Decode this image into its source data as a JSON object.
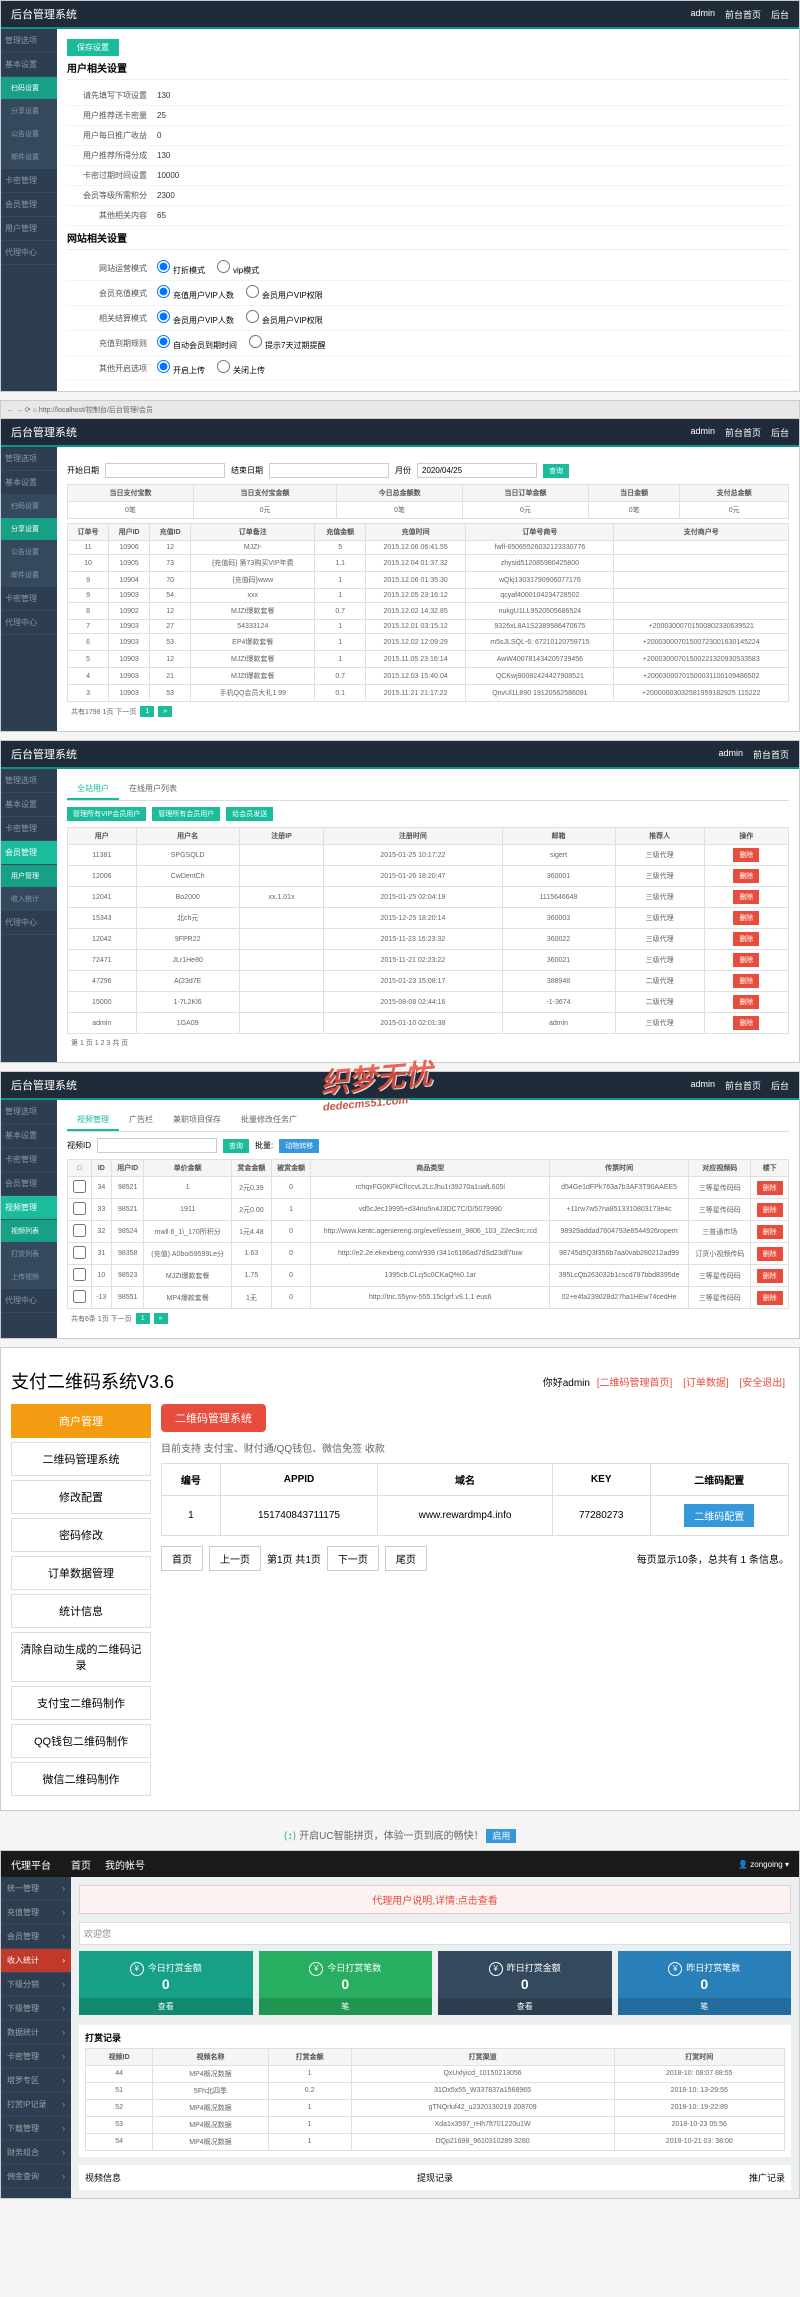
{
  "common": {
    "brand": "后台管理系统",
    "topRight": [
      "admin",
      "前台首页",
      "后台"
    ],
    "sidebarTop": [
      "管理选项",
      "基本设置"
    ],
    "sidebarSub": [
      "扫码设置",
      "分享设置",
      "公告设置",
      "邮件设置"
    ],
    "sidebarBottom": [
      "卡密管理",
      "会员管理",
      "用户管理",
      "代理中心"
    ]
  },
  "panel1": {
    "saveBtn": "保存设置",
    "section1": "用户相关设置",
    "rows1": [
      {
        "label": "请先填写下项设置",
        "value": "130"
      },
      {
        "label": "用户推荐送卡密量",
        "value": "25"
      },
      {
        "label": "用户每日推广收益",
        "value": "0"
      },
      {
        "label": "用户推荐所得分成",
        "value": "130"
      },
      {
        "label": "卡密过期时间设置",
        "value": "10000"
      },
      {
        "label": "会员等级所需积分",
        "value": "2300"
      },
      {
        "label": "其他相关内容",
        "value": "65"
      }
    ],
    "section2": "网站相关设置",
    "radioRows": [
      {
        "label": "网站运营模式",
        "opts": [
          "打折模式",
          "vip模式"
        ]
      },
      {
        "label": "会员充值模式",
        "opts": [
          "充值用户VIP人数",
          "会员用户VIP权限"
        ]
      },
      {
        "label": "相关结算模式",
        "opts": [
          "会员用户VIP人数",
          "会员用户VIP权限"
        ]
      },
      {
        "label": "充值到期规则",
        "opts": [
          "自动会员到期时间",
          "提示7天过期提醒"
        ]
      },
      {
        "label": "其他开启选项",
        "opts": [
          "开启上传",
          "关闭上传"
        ]
      }
    ]
  },
  "panel2": {
    "chrome": "← → ⟳ ⌂ http://localhost/控制台/后台管理/会员",
    "filter": {
      "start": "开始日期",
      "end": "结束日期",
      "month": "月份",
      "monthVal": "2020/04/25",
      "search": "查询"
    },
    "subHeaders": [
      "当日支付宝数",
      "当日支付宝金额",
      "今日总金额数",
      "当日订单金额",
      "当日金额",
      "支付总金额"
    ],
    "subValues": [
      "0笔",
      "0元",
      "0笔",
      "0元",
      "0笔",
      "0元"
    ],
    "cols": [
      "订单号",
      "用户ID",
      "充值ID",
      "订单备注",
      "充值金额",
      "充值时间",
      "订单号商号",
      "支付商户号"
    ],
    "rows": [
      [
        "11",
        "10906",
        "12",
        "MJZt-",
        "5",
        "2015.12.06 06:41.55",
        "fwfl-65065526032123330776",
        ""
      ],
      [
        "10",
        "10905",
        "73",
        "{充值码} 第73购买VIP年费",
        "1.1",
        "2015.12.04 01:37.32",
        "zhysid512085980425800",
        ""
      ],
      [
        "9",
        "10904",
        "70",
        "{充值码}www",
        "1",
        "2015.12.06 01:35.30",
        "wQkj13031790906077176",
        ""
      ],
      [
        "9",
        "10903",
        "54",
        "xxx",
        "1",
        "2015.12.05 23:16:12",
        "qcyaf4000104234728502",
        ""
      ],
      [
        "8",
        "10902",
        "12",
        "MJZt爆款套餐",
        "0.7",
        "2015.12.02 14:32.85",
        "nukgU1LL9520505686524",
        ""
      ],
      [
        "7",
        "10903",
        "27",
        "54333124",
        "1",
        "2015.12.01 03:15.12",
        "9326xL8A1S2389586470675",
        "+20003000701500802330639521"
      ],
      [
        "6",
        "10903",
        "53",
        "EP4爆款套餐",
        "1",
        "2015.12.02 12:09:29",
        "m5sJLSQL-6: 67210120759715",
        "+20003000701500723001630145224"
      ],
      [
        "5",
        "10903",
        "12",
        "MJZt爆款套餐",
        "1",
        "2015.11.05 23:16:14",
        "AwW400781434205739456",
        "+20003000701500221320930533583"
      ],
      [
        "4",
        "10903",
        "21",
        "MJZt爆款套餐",
        "0.7",
        "2015.12.03 15:40.04",
        "QCKwj90082424427908521",
        "+20003000701500031100109486502"
      ],
      [
        "3",
        "10903",
        "53",
        "手机QQ会员大礼1.99",
        "0.1",
        "2015.11.21 21:17:22",
        "QnvUl1L890 19120562586091",
        "+20000003032581959182925 115222"
      ]
    ],
    "pager": "共有1798 1页 下一页"
  },
  "panel3": {
    "tabs": [
      "全站用户",
      "在线用户列表"
    ],
    "btns": [
      "管理所有VIP会员用户",
      "管理所有会员用户",
      "给会员发送"
    ],
    "cols": [
      "用户",
      "用户名",
      "注册IP",
      "注册时间",
      "邮箱",
      "推荐人",
      "操作"
    ],
    "rows": [
      [
        "11381",
        "SPGSQLD",
        "",
        "2015-01-25 10:17:22",
        "sigert",
        "三级代理",
        "删除"
      ],
      [
        "12006",
        "CwDentCh",
        "",
        "2015-01-26 18:20:47",
        "360001",
        "三级代理",
        "删除"
      ],
      [
        "12041",
        "Bo2000",
        "xx.1.01x",
        "2015-01-25 02:04:19",
        "1115646648",
        "三级代理",
        "删除"
      ],
      [
        "15343",
        "北ch元",
        "",
        "2015-12-25 18:20:14",
        "360003",
        "三级代理",
        "删除"
      ],
      [
        "12042",
        "9FPR22",
        "",
        "2015-11-23 16:23:32",
        "360022",
        "三级代理",
        "删除"
      ],
      [
        "72471",
        "JLr1He80",
        "",
        "2015-11-21 02:23:22",
        "360021",
        "三级代理",
        "删除"
      ],
      [
        "47296",
        "A(23d7E",
        "",
        "2015-01-23 15:08:17",
        "388948",
        "二级代理",
        "删除"
      ],
      [
        "15000",
        "1-7L2Kl6",
        "",
        "2015-08-08 02:44:16",
        "-1-3674",
        "二级代理",
        "删除"
      ],
      [
        "admin",
        "1GA09",
        "",
        "2015-01-10 02:01:38",
        "admin",
        "三级代理",
        "删除"
      ]
    ],
    "pager": "第 1 页 1 2 3 共 页"
  },
  "panel4": {
    "tabs": [
      "视频管理",
      "广告栏",
      "兼职项目保存",
      "批量修改任务广"
    ],
    "watermark": "织梦无忧",
    "watermarkUrl": "dedecms51.com",
    "cols": [
      "□",
      "ID",
      "用户ID",
      "单价金额",
      "赏金金额",
      "被赏金额",
      "商品类型",
      "传票时间",
      "对应视频码",
      "楼下"
    ],
    "rows": [
      [
        "□",
        "34",
        "98521",
        "1",
        "2元0.39",
        "0",
        "rchqxFG0KFkCfIccvL2LcJhu1r39270a1uafL605l",
        "d54Ge1dFPk763a7b3AF3T90AAEE5",
        "三等星传码码",
        "删除"
      ],
      [
        "□",
        "33",
        "98521",
        "1911",
        "2元0.00",
        "1",
        "vd5cJec19995+d34nu5n4J3DC7C/D/5079990",
        "+11rw7w57na8513310803173e4c",
        "三等星传码码",
        "删除"
      ],
      [
        "□",
        "32",
        "98524",
        "mwll 6_1\\_170所积分",
        "1元4.48",
        "0",
        "http://www.kentc.ageniereng.org/evef/essent_9806_103_22ec9rc.rcd",
        "98929addad7604793e8544926ropem",
        "三普通市场",
        "删除"
      ],
      [
        "□",
        "31",
        "98358",
        "(充值) A0boi59599Le分",
        "1.63",
        "0",
        "http://e2.2e.ekexberg.com/r939 r341c6186ad7dSd23df7tuw",
        "98745d5Q3f356b7aa0vab280212ad99",
        "订货小视频传码",
        "删除"
      ],
      [
        "□",
        "10",
        "98523",
        "MJZt爆款套餐",
        "1.75",
        "0",
        "1395cb.CLcj5c0CKaQ%0.1ar",
        "395LcQb263032b1cscd797bbd8395de",
        "三等星传码码",
        "删除"
      ],
      [
        "□",
        "-13",
        "98551",
        "MP4爆款套餐",
        "1无",
        "0",
        "http://tnc.55ynv-555.15clgrf.v9.1.1 eus6",
        "02+e4fa239028d27ha1HEw74cedHe",
        "三等星传码码",
        "删除"
      ]
    ],
    "pager": "共有6条 1页 下一页"
  },
  "panel5": {
    "title": "支付二维码系统V3.6",
    "greet": "你好admin",
    "links": [
      "[二维码管理首页]",
      "[订单数据]",
      "[安全退出]"
    ],
    "side": [
      "商户管理",
      "二维码管理系统",
      "修改配置",
      "密码修改",
      "订单数据管理",
      "统计信息",
      "清除自动生成的二维码记录",
      "支付宝二维码制作",
      "QQ钱包二维码制作",
      "微信二维码制作"
    ],
    "redBtn": "二维码管理系统",
    "support": "目前支持 支付宝、财付通/QQ钱包、微信免签 收款",
    "cols": [
      "编号",
      "APPID",
      "域名",
      "KEY",
      "二维码配置"
    ],
    "row": [
      "1",
      "151740843711175",
      "www.rewardmp4.info",
      "77280273",
      "二维码配置"
    ],
    "pagerBtns": [
      "首页",
      "上一页",
      "下一页",
      "尾页"
    ],
    "pagerInfo1": "第1页   共1页",
    "pagerInfo2": "每页显示10条，总共有 1 条信息。",
    "ucBar": "开启UC智能拼页，体验一页到底的畅快！",
    "ucEnable": "启用"
  },
  "panel6": {
    "brand": "代理平台",
    "topItems": [
      "首页",
      "我的帐号"
    ],
    "topRight": "zongoing",
    "side": [
      "统一管理",
      "充值管理",
      "会员管理",
      "收入统计",
      "下级分销",
      "下级管理",
      "数据统计",
      "卡密管理",
      "塔罗专区",
      "打赏IP记录",
      "下载管理",
      "财务组合",
      "佣金查询"
    ],
    "alert": "代理用户说明,详情:点击查看",
    "recent": "欢迎您",
    "cards": [
      {
        "label": "今日打赏金额",
        "num": "0",
        "foot": "查看"
      },
      {
        "label": "今日打赏笔数",
        "num": "0",
        "foot": "笔"
      },
      {
        "label": "昨日打赏金额",
        "num": "0",
        "foot": "查看"
      },
      {
        "label": "昨日打赏笔数",
        "num": "0",
        "foot": "笔"
      }
    ],
    "tblTitle": "打赏记录",
    "cols": [
      "视频ID",
      "视频名称",
      "打赏金额",
      "打赏渠道",
      "打赏时间"
    ],
    "rows": [
      [
        "44",
        "MP4概况数据",
        "1",
        "QxUxlyicd_10150213056",
        "2018-10: 08:07 88:55"
      ],
      [
        "51",
        "5Fh北四季",
        "0.2",
        "31Ox5x55_W337837a1568965",
        "2018-10: 13-29:55"
      ],
      [
        "52",
        "MP4概况数据",
        "1",
        "gTNQrluf42_u2320130219 208709",
        "2018-10: 19-22:89"
      ],
      [
        "53",
        "MP4概况数据",
        "1",
        "Xda1x3597_rHh7ft701220u1W",
        "2018-10-23 05:56"
      ],
      [
        "54",
        "MP4概况数据",
        "1",
        "DQp21698_9610310289 3280",
        "2018-10-21 03: 38:00"
      ]
    ],
    "bottomTabs": [
      "视频信息",
      "提现记录",
      "推广记录"
    ]
  }
}
